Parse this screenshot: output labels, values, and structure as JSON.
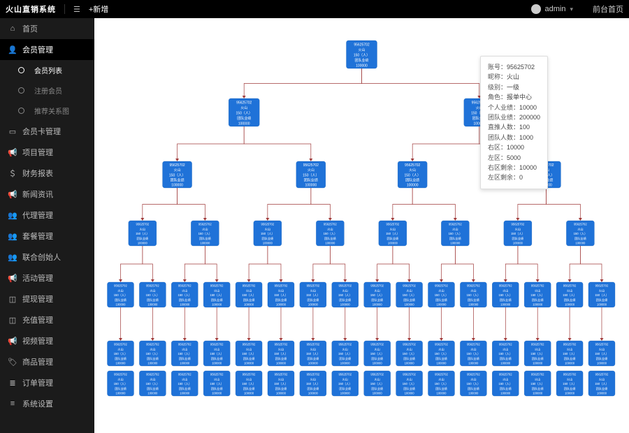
{
  "topbar": {
    "brand": "火山直销系统",
    "add_label": "+新增",
    "user": "admin",
    "front_link": "前台首页"
  },
  "sidebar": {
    "items": [
      {
        "icon": "home",
        "label": "首页"
      },
      {
        "icon": "user",
        "label": "会员管理",
        "active": true,
        "children": [
          {
            "label": "会员列表",
            "selected": true
          },
          {
            "label": "注册会员"
          },
          {
            "label": "推荐关系图"
          }
        ]
      },
      {
        "icon": "card",
        "label": "会员卡管理"
      },
      {
        "icon": "megaphone",
        "label": "项目管理"
      },
      {
        "icon": "money",
        "label": "财务报表"
      },
      {
        "icon": "megaphone",
        "label": "新闻资讯"
      },
      {
        "icon": "users",
        "label": "代理管理"
      },
      {
        "icon": "users",
        "label": "套餐管理"
      },
      {
        "icon": "users",
        "label": "联合创始人"
      },
      {
        "icon": "megaphone",
        "label": "活动管理"
      },
      {
        "icon": "wallet",
        "label": "提现管理"
      },
      {
        "icon": "wallet",
        "label": "充值管理"
      },
      {
        "icon": "megaphone",
        "label": "视频管理"
      },
      {
        "icon": "tag",
        "label": "商品管理"
      },
      {
        "icon": "list",
        "label": "订单管理"
      },
      {
        "icon": "bars",
        "label": "系统设置"
      }
    ]
  },
  "node_template": {
    "id": "95625702",
    "name": "火山",
    "count_label": "150（人）",
    "perf_label": "团队业绩",
    "perf_value": "100000"
  },
  "popover": {
    "rows": [
      {
        "k": "账号",
        "v": "95625702"
      },
      {
        "k": "昵称",
        "v": "火山"
      },
      {
        "k": "级别",
        "v": "一级"
      },
      {
        "k": "角色",
        "v": "报单中心"
      },
      {
        "k": "个人业绩",
        "v": "10000"
      },
      {
        "k": "团队业绩",
        "v": "200000"
      },
      {
        "k": "直推人数",
        "v": "100"
      },
      {
        "k": "团队人数",
        "v": "1000"
      },
      {
        "k": "右区",
        "v": "10000"
      },
      {
        "k": "左区",
        "v": "5000"
      },
      {
        "k": "右区剩余",
        "v": "10000"
      },
      {
        "k": "左区剩余",
        "v": "0"
      }
    ]
  },
  "icon_glyphs": {
    "home": "⌂",
    "user": "👤",
    "card": "▭",
    "megaphone": "📢",
    "money": "＄",
    "users": "👥",
    "wallet": "◫",
    "tag": "🏷",
    "list": "≣",
    "bars": "≡",
    "menu": "☰"
  }
}
